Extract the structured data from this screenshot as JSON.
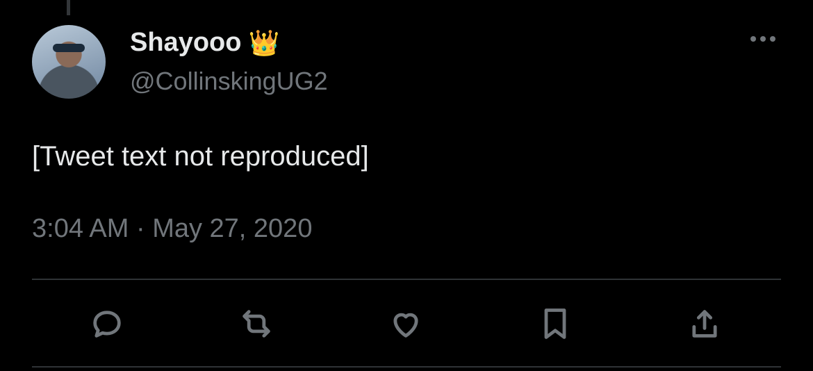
{
  "tweet": {
    "author": {
      "display_name": "Shayooo",
      "badge_emoji": "👑",
      "handle": "@CollinskingUG2"
    },
    "text": "[Tweet text not reproduced]",
    "timestamp": "3:04 AM · May 27, 2020"
  },
  "icons": {
    "more": "more-icon",
    "reply": "reply-icon",
    "retweet": "retweet-icon",
    "like": "like-icon",
    "bookmark": "bookmark-icon",
    "share": "share-icon"
  },
  "colors": {
    "background": "#000000",
    "primary_text": "#e7e9ea",
    "secondary_text": "#71767b",
    "divider": "#2f3336"
  }
}
